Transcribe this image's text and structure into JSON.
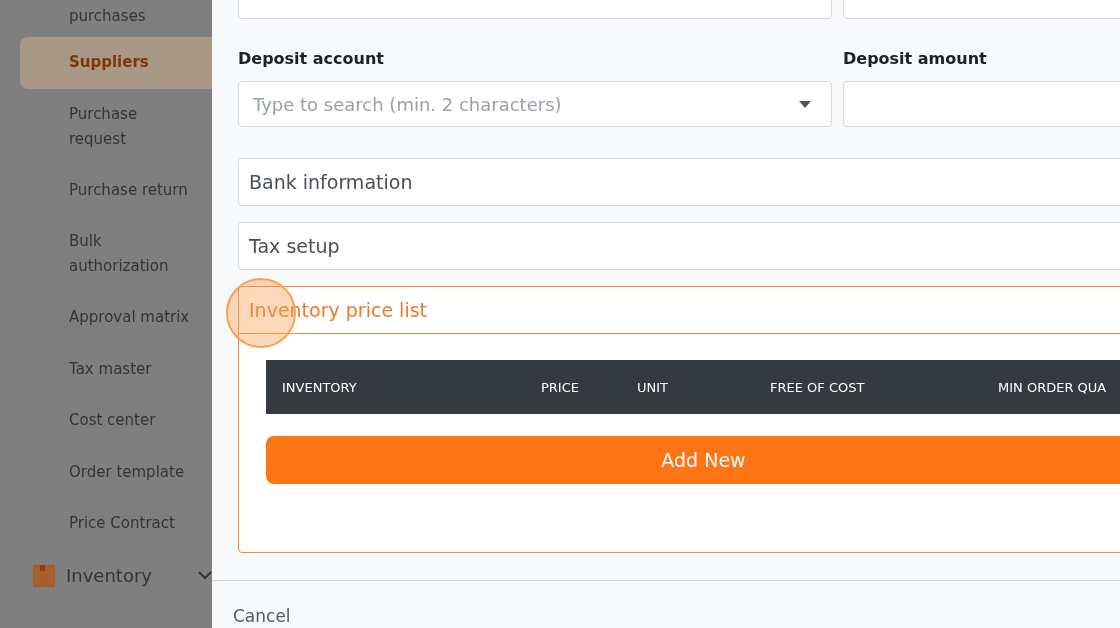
{
  "sidebar": {
    "items": [
      {
        "label": "purchases",
        "selected": false
      },
      {
        "label": "Suppliers",
        "selected": true
      },
      {
        "label": "Purchase request",
        "selected": false
      },
      {
        "label": "Purchase return",
        "selected": false
      },
      {
        "label": "Bulk authorization",
        "selected": false
      },
      {
        "label": "Approval matrix",
        "selected": false
      },
      {
        "label": "Tax master",
        "selected": false
      },
      {
        "label": "Cost center",
        "selected": false
      },
      {
        "label": "Order template",
        "selected": false
      },
      {
        "label": "Price Contract",
        "selected": false
      }
    ],
    "group": {
      "label": "Inventory",
      "expanded": true
    }
  },
  "form": {
    "deposit_account": {
      "label": "Deposit account",
      "placeholder": "Type to search (min. 2 characters)"
    },
    "deposit_amount": {
      "label": "Deposit amount"
    },
    "sections": [
      {
        "title": "Bank information",
        "expanded": false
      },
      {
        "title": "Tax setup",
        "expanded": false
      },
      {
        "title": "Inventory price list",
        "expanded": true
      }
    ],
    "table": {
      "columns": [
        "INVENTORY",
        "PRICE",
        "UNIT",
        "FREE OF COST",
        "MIN ORDER QUA"
      ]
    },
    "add_button": "Add New"
  },
  "footer": {
    "cancel": "Cancel"
  }
}
